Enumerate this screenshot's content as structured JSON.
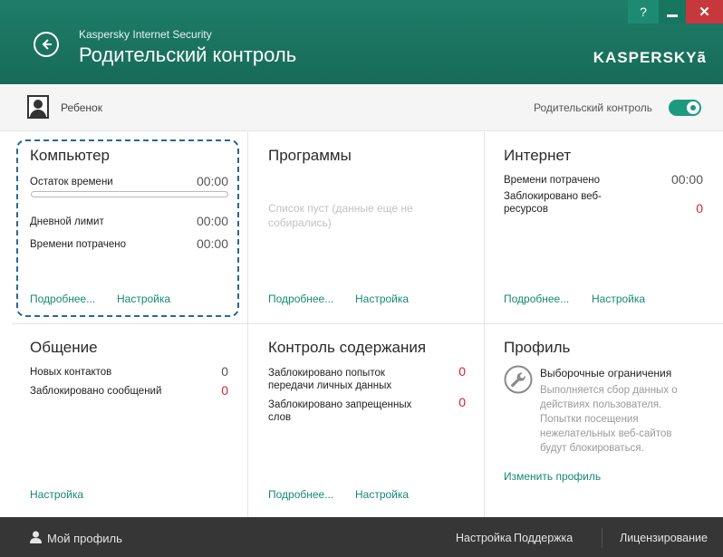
{
  "window": {
    "app_name": "Kaspersky Internet Security",
    "title": "Родительский контроль",
    "brand": "KASPERSKY",
    "brand_suffix": "ã",
    "help_label": "?",
    "close_label": "✕",
    "back_icon": "back-arrow-icon"
  },
  "user": {
    "name": "Ребенок",
    "parental_control_label": "Родительский контроль",
    "parental_control_on": true
  },
  "panels": {
    "computer": {
      "title": "Компьютер",
      "time_left_label": "Остаток времени",
      "time_left_value": "00:00",
      "progress": 0,
      "daily_limit_label": "Дневной лимит",
      "daily_limit_value": "00:00",
      "time_spent_label": "Времени потрачено",
      "time_spent_value": "00:00",
      "details_link": "Подробнее...",
      "settings_link": "Настройка"
    },
    "programs": {
      "title": "Программы",
      "empty_text_1": "Список пуст (данные еще не",
      "empty_text_2": "собирались)",
      "details_link": "Подробнее...",
      "settings_link": "Настройка"
    },
    "internet": {
      "title": "Интернет",
      "time_spent_label": "Времени потрачено",
      "time_spent_value": "00:00",
      "blocked_label_1": "Заблокировано веб-",
      "blocked_label_2": "ресурсов",
      "blocked_value": "0",
      "details_link": "Подробнее...",
      "settings_link": "Настройка"
    },
    "communication": {
      "title": "Общение",
      "new_contacts_label": "Новых контактов",
      "new_contacts_value": "0",
      "blocked_messages_label": "Заблокировано сообщений",
      "blocked_messages_value": "0",
      "settings_link": "Настройка"
    },
    "content": {
      "title": "Контроль содержания",
      "blocked_personal_label_1": "Заблокировано попыток",
      "blocked_personal_label_2": "передачи личных данных",
      "blocked_personal_value": "0",
      "blocked_words_label_1": "Заблокировано запрещенных",
      "blocked_words_label_2": "слов",
      "blocked_words_value": "0",
      "details_link": "Подробнее...",
      "settings_link": "Настройка"
    },
    "profile": {
      "title": "Профиль",
      "profile_name": "Выборочные ограничения",
      "desc": [
        "Выполняется сбор данных о",
        "действиях пользователя.",
        "Попытки посещения",
        "нежелательных веб-сайтов",
        "будут блокироваться."
      ],
      "change_link": "Изменить профиль"
    }
  },
  "footer": {
    "my_profile": "Мой профиль",
    "settings": "Настройка",
    "support": "Поддержка",
    "licensing": "Лицензирование"
  },
  "colors": {
    "header": "#176b58",
    "accent": "#1d9a7d",
    "link": "#138a72",
    "alert": "#d9232e",
    "footer": "#363636"
  }
}
